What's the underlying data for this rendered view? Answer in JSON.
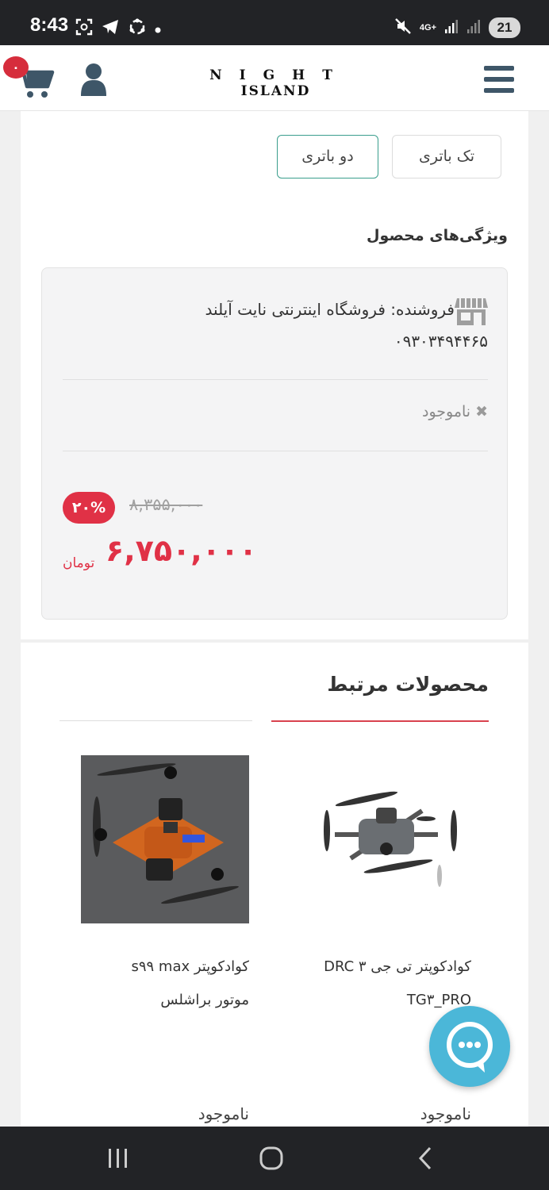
{
  "status_bar": {
    "time": "8:43",
    "network": "4G+",
    "battery": "21",
    "icons": [
      "screenshot-icon",
      "telegram-icon",
      "sync-icon",
      "dot-icon",
      "mute-icon",
      "signal-icon",
      "signal-icon",
      "battery-icon"
    ]
  },
  "header": {
    "cart_count": "۰",
    "logo_line1": "NIGHT",
    "logo_line2": "ISLAND",
    "icons": [
      "cart-icon",
      "user-icon",
      "menu-icon"
    ]
  },
  "options": {
    "single": "تک باتری",
    "double": "دو باتری",
    "selected": "double"
  },
  "features": {
    "title": "ویژگی‌های محصول",
    "seller": "فروشنده: فروشگاه اینترنتی نایت آیلند",
    "phone": "۰۹۳۰۳۴۹۴۴۶۵",
    "stock": "ناموجود",
    "discount": "۲۰%",
    "old_price": "۸,۳۵۵,۰۰۰",
    "new_price": "۶,۷۵۰,۰۰۰",
    "currency": "تومان"
  },
  "related": {
    "title": "محصولات مرتبط",
    "products": [
      {
        "name_line1": "کوادکوپتر تی جی ۳ DRC",
        "name_line2": "TG۳_PRO",
        "stock": "ناموجود"
      },
      {
        "name_line1": "کوادکوپتر s۹۹ max",
        "name_line2": "موتور براشلس",
        "stock": "ناموجود"
      }
    ]
  },
  "colors": {
    "accent_red": "#e03146",
    "selected_border": "#3a9e8d",
    "chat_fab": "#4bb7d8",
    "icon_dark": "#3e5668"
  }
}
